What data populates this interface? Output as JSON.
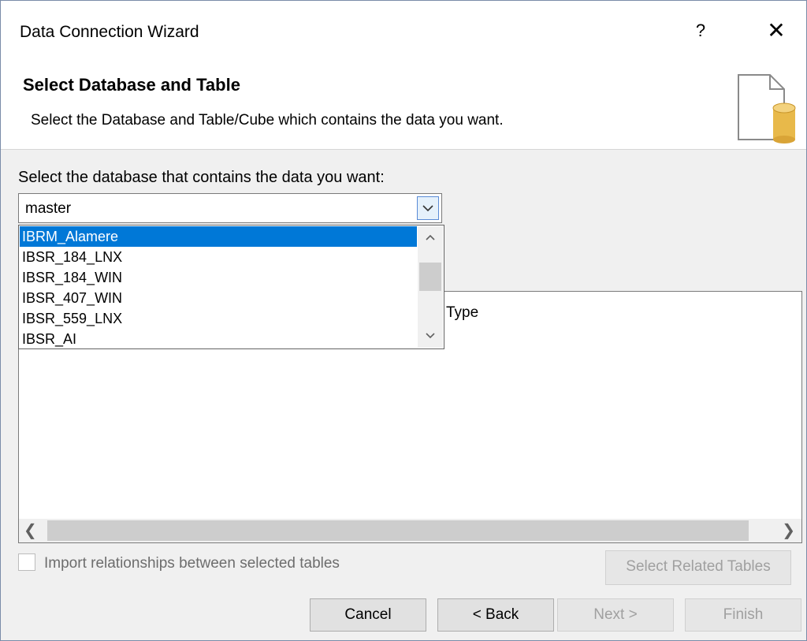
{
  "window": {
    "title": "Data Connection Wizard",
    "help_icon": "?",
    "close_icon": "✕"
  },
  "header": {
    "title": "Select Database and Table",
    "subtitle": "Select the Database and Table/Cube which contains the data you want."
  },
  "database": {
    "label": "Select the database that contains the data you want:",
    "selected": "master",
    "options": [
      "IBRM_Alamere",
      "IBSR_184_LNX",
      "IBSR_184_WIN",
      "IBSR_407_WIN",
      "IBSR_559_LNX",
      "IBSR_AI"
    ],
    "highlighted_option": "IBRM_Alamere"
  },
  "table_list": {
    "type_header": "Type"
  },
  "import_relationships": {
    "label": "Import relationships between selected tables",
    "checked": false
  },
  "buttons": {
    "select_related": "Select Related Tables",
    "cancel": "Cancel",
    "back": "< Back",
    "next": "Next >",
    "finish": "Finish"
  },
  "colors": {
    "selection": "#0078d7",
    "dialog_bg": "#f0f0f0",
    "db_icon": "#e8b94a"
  },
  "icons": {
    "dialog_graphic": "database-document-icon",
    "dropdown": "chevron-down-icon"
  }
}
